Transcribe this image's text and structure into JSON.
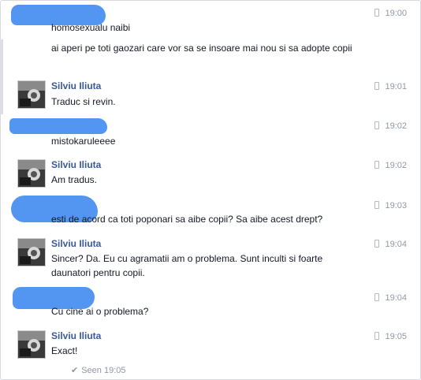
{
  "messages": [
    {
      "sender": "",
      "lines": [
        "homosexualu naibi"
      ],
      "time": "19:00"
    },
    {
      "sender": "",
      "lines": [
        "ai aperi pe toti gaozari care vor sa se insoare mai nou si sa adopte copii"
      ],
      "time": ""
    },
    {
      "sender": "Silviu Iliuta",
      "lines": [
        "Traduc si revin."
      ],
      "time": "19:01"
    },
    {
      "sender": "",
      "lines": [
        "mistokaruleeee"
      ],
      "time": "19:02"
    },
    {
      "sender": "Silviu Iliuta",
      "lines": [
        "Am tradus."
      ],
      "time": "19:02"
    },
    {
      "sender": "",
      "lines": [
        "esti de acord ca toti poponari sa aibe copii? Sa aibe acest drept?"
      ],
      "time": "19:03"
    },
    {
      "sender": "Silviu Iliuta",
      "lines": [
        "Sincer? Da. Eu cu agramatii am o problema. Sunt inculti si foarte daunatori pentru copii."
      ],
      "time": "19:04"
    },
    {
      "sender": "",
      "lines": [
        "Cu cine ai o problema?"
      ],
      "time": "19:04"
    },
    {
      "sender": "Silviu Iliuta",
      "lines": [
        "Exact!"
      ],
      "time": "19:05"
    }
  ],
  "seen": {
    "label": "Seen 19:05"
  },
  "icons": {
    "time": "mobile-phone-icon",
    "seen": "checkmark-icon"
  }
}
